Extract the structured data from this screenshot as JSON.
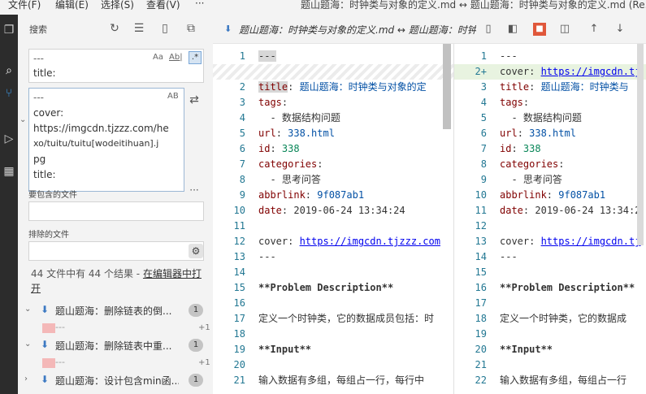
{
  "menubar": {
    "items": [
      "文件(F)",
      "编辑(E)",
      "选择(S)",
      "查看(V)",
      "···"
    ],
    "window_title": "题山题海：时钟类与对象的定义.md ↔ 题山题海：时钟类与对象的定义.md (Re..."
  },
  "sidebar": {
    "title": "搜索",
    "search_box": {
      "lines": [
        "---",
        "title:"
      ],
      "options": [
        "Aa",
        "Ab|",
        ".*"
      ]
    },
    "replace_box": {
      "lines": [
        "---",
        "cover:",
        "https://imgcdn.tjzzz.com/he",
        "xo/tuitu/tuitu[wodeitihuan].j",
        "pg",
        "title:"
      ],
      "option": "AB"
    },
    "include_label": "要包含的文件",
    "include_value": "",
    "exclude_label": "排除的文件",
    "exclude_value": "",
    "result_message": "44 文件中有 44 个结果 - ",
    "open_in_editor": "在编辑器中打开",
    "results": [
      {
        "name": "题山题海：删除链表的倒...",
        "count": "1",
        "match": "---",
        "plus": "+1"
      },
      {
        "name": "题山题海：删除链表中重...",
        "count": "1",
        "match": "---",
        "plus": "+1"
      },
      {
        "name": "题山题海：设计包含min函...",
        "count": "1"
      }
    ]
  },
  "tab": {
    "label": "题山题海：时钟类与对象的定义.md ↔ 题山题海：时钟类与对象的定义.md (Re..."
  },
  "left_pane": {
    "lines": [
      {
        "n": "1",
        "text": "---"
      },
      {
        "n": "",
        "text": ""
      },
      {
        "n": "2",
        "key": "title",
        "val": " 题山题海：时钟类与对象的定"
      },
      {
        "n": "3",
        "key": "tags",
        "val": ""
      },
      {
        "n": "4",
        "text": "  - 数据结构问题"
      },
      {
        "n": "5",
        "key": "url",
        "val": " 338.html"
      },
      {
        "n": "6",
        "key": "id",
        "val": " 338"
      },
      {
        "n": "7",
        "key": "categories",
        "val": ""
      },
      {
        "n": "8",
        "text": "  - 思考问答"
      },
      {
        "n": "9",
        "key": "abbrlink",
        "val": " 9f087ab1"
      },
      {
        "n": "10",
        "key": "date",
        "val": " 2019-06-24 13:34:24"
      },
      {
        "n": "11",
        "text": ""
      },
      {
        "n": "12",
        "link_prefix": "cover: ",
        "link": "https://imgcdn.tjzzz.com"
      },
      {
        "n": "13",
        "text": "---"
      },
      {
        "n": "14",
        "text": ""
      },
      {
        "n": "15",
        "bold": "**Problem Description**"
      },
      {
        "n": "16",
        "text": ""
      },
      {
        "n": "17",
        "text": "定义一个时钟类，它的数据成员包括：时"
      },
      {
        "n": "18",
        "text": ""
      },
      {
        "n": "19",
        "bold": "**Input**"
      },
      {
        "n": "20",
        "text": ""
      },
      {
        "n": "21",
        "text": "输入数据有多组，每组占一行，每行中"
      }
    ]
  },
  "right_pane": {
    "lines": [
      {
        "n": "1",
        "text": "---"
      },
      {
        "n": "2+",
        "link_prefix": "cover: ",
        "link": "https://imgcdn.tj"
      },
      {
        "n": "3",
        "key": "title",
        "val": " 题山题海：时钟类与"
      },
      {
        "n": "4",
        "key": "tags",
        "val": ""
      },
      {
        "n": "5",
        "text": "  - 数据结构问题"
      },
      {
        "n": "6",
        "key": "url",
        "val": " 338.html"
      },
      {
        "n": "7",
        "key": "id",
        "val": " 338"
      },
      {
        "n": "8",
        "key": "categories",
        "val": ""
      },
      {
        "n": "9",
        "text": "  - 思考问答"
      },
      {
        "n": "10",
        "key": "abbrlink",
        "val": " 9f087ab1"
      },
      {
        "n": "11",
        "key": "date",
        "val": " 2019-06-24 13:34:2"
      },
      {
        "n": "12",
        "text": ""
      },
      {
        "n": "13",
        "link_prefix": "cover: ",
        "link": "https://imgcdn.tj"
      },
      {
        "n": "14",
        "text": "---"
      },
      {
        "n": "15",
        "text": ""
      },
      {
        "n": "16",
        "bold": "**Problem Description**"
      },
      {
        "n": "17",
        "text": ""
      },
      {
        "n": "18",
        "text": "定义一个时钟类，它的数据成"
      },
      {
        "n": "19",
        "text": ""
      },
      {
        "n": "20",
        "bold": "**Input**"
      },
      {
        "n": "21",
        "text": ""
      },
      {
        "n": "22",
        "text": "输入数据有多组，每组占一行"
      }
    ]
  },
  "colors": {
    "link": "#0000ee",
    "key": "#800000",
    "line_number": "#237893",
    "deleted_bg": "#f4b8b8",
    "inserted_bg": "#e8f3e0"
  }
}
